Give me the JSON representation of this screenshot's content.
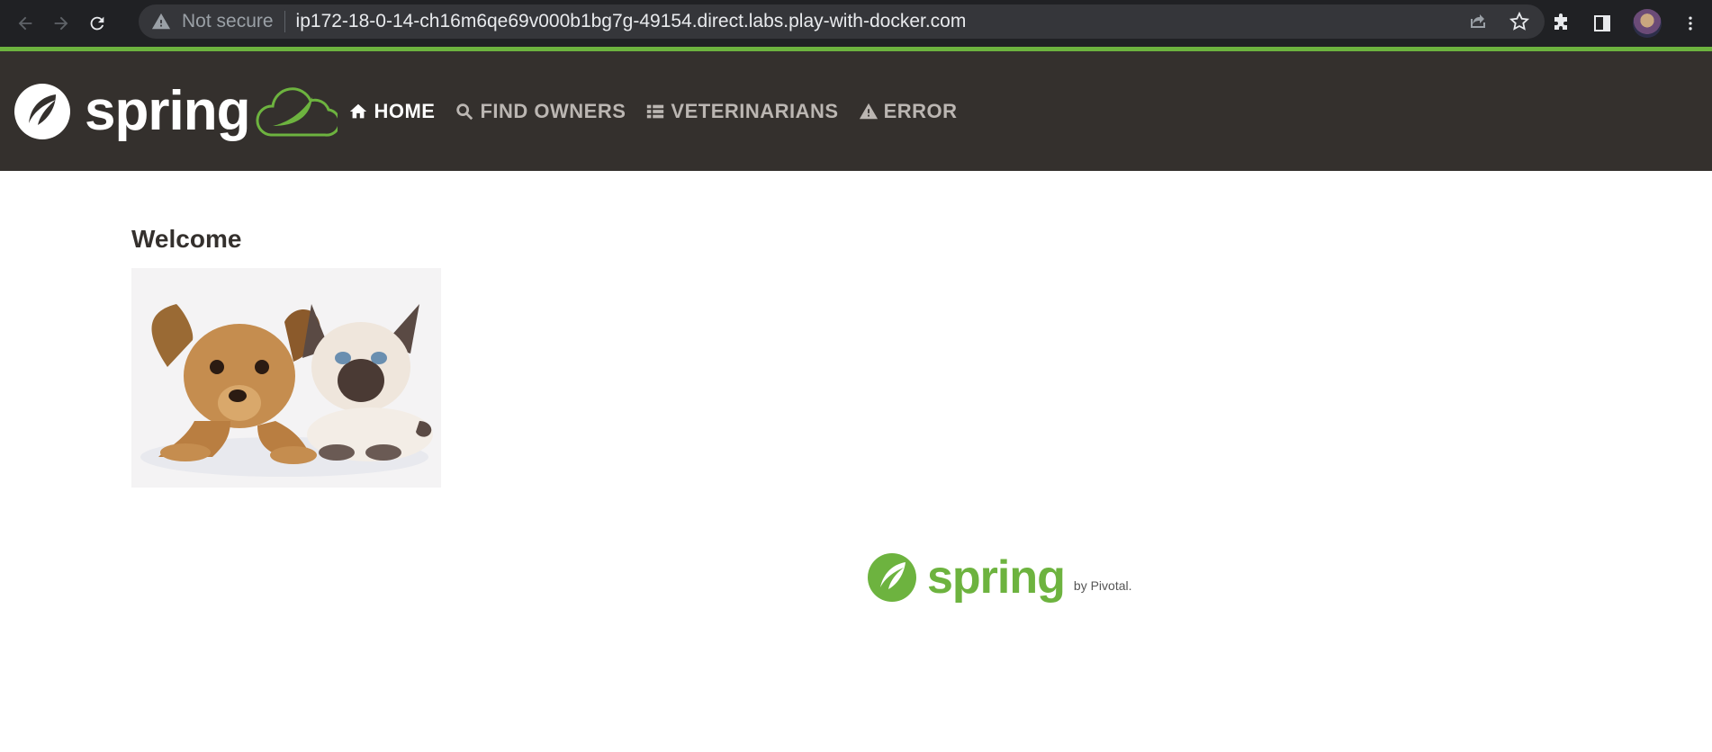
{
  "browser": {
    "security_label": "Not secure",
    "url": "ip172-18-0-14-ch16m6qe69v000b1bg7g-49154.direct.labs.play-with-docker.com",
    "icons": [
      "back-icon",
      "forward-icon",
      "reload-icon",
      "warning-icon",
      "share-icon",
      "star-icon",
      "extensions-icon",
      "sidebar-icon",
      "avatar",
      "menu-icon"
    ]
  },
  "navbar": {
    "brand": "spring",
    "items": [
      {
        "label": "HOME",
        "icon": "home-icon",
        "active": true
      },
      {
        "label": "FIND OWNERS",
        "icon": "search-icon",
        "active": false
      },
      {
        "label": "VETERINARIANS",
        "icon": "list-icon",
        "active": false
      },
      {
        "label": "ERROR",
        "icon": "warning-icon",
        "active": false
      }
    ]
  },
  "main": {
    "title": "Welcome"
  },
  "footer": {
    "brand": "spring",
    "byline": "by Pivotal."
  },
  "colors": {
    "navbar_bg": "#34302d",
    "accent_green": "#6db33f",
    "chrome_bg": "#202124"
  }
}
